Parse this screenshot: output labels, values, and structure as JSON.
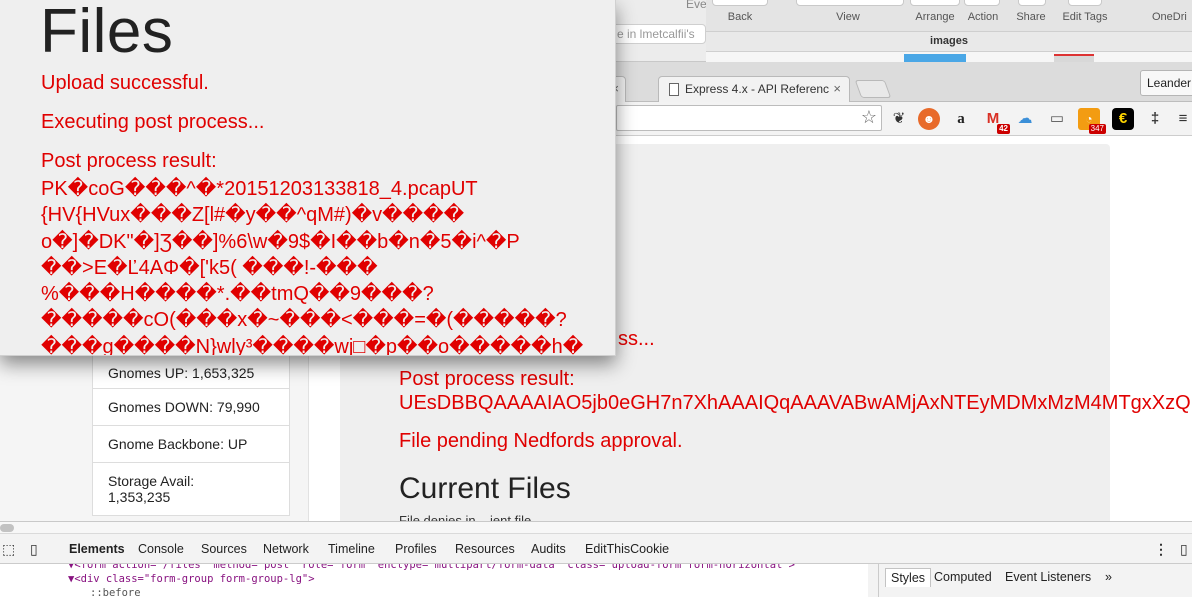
{
  "finder": {
    "top_label": "Eve",
    "search_placeholder": "e in lmetcalfii's",
    "toolbar": [
      "Back",
      "View",
      "Arrange",
      "Action",
      "Share",
      "Edit Tags",
      "OneDri"
    ],
    "path": "images"
  },
  "chrome_back": {
    "tab_title": "Express 4.x - API Referenc",
    "tab_close": "×",
    "profile": "Leander",
    "ext_badges": {
      "gmail": "42",
      "rss": "347"
    },
    "star": "☆"
  },
  "front": {
    "heading": "Files",
    "upload": "Upload successful.",
    "executing": "Executing post process...",
    "post_result_label": "Post process result:",
    "garbage_lines": [
      "PK�coG���^�*20151203133818_4.pcapUT",
      "{HV{HVux���Z[l#�y��^qM#)�v����",
      "o�]�DK\"�]Ʒ��]%6\\w�9$�I��b�n�5�i^�P",
      "��>E�Ľ4AΦ�['k5( ���!-���",
      "%���H����*.��tmQ��9���?",
      "�����ϲO(���x�~���<���=�(�����?",
      "���g����N}wly³����wj□�p��o�����h�",
      "�����������"
    ]
  },
  "page": {
    "stats": [
      "Gnomes UP: 1,653,325",
      "Gnomes DOWN: 79,990",
      "Gnome Backbone: UP",
      "Storage Avail:",
      "1,353,235"
    ],
    "executing_tail": "ss...",
    "post_result_label": "Post process result:",
    "post_result_value": "UEsDBBQAAAAIAO5jb0eGH7n7XhAAAIQqAAAVABwAMjAxNTEyMDMxMzM4MTgxXzQucGNhcFVUCQADiGh",
    "pending": "File pending Nedfords approval.",
    "current_files": "Current Files",
    "sub_text": "File denies in ...ient file ..."
  },
  "devtools": {
    "tabs": [
      "Elements",
      "Console",
      "Sources",
      "Network",
      "Timeline",
      "Profiles",
      "Resources",
      "Audits",
      "EditThisCookie"
    ],
    "code": [
      "▼<form action=\"/files\" method=\"post\" role=\"form\" enctype=\"multipart/form-data\" class=\"upload-form form-horizontal\">",
      "  ▼<div class=\"form-group form-group-lg\">",
      "      ::before"
    ],
    "side_tabs": [
      "Styles",
      "Computed",
      "Event Listeners",
      "»"
    ]
  },
  "colors": {
    "error_red": "#e00000",
    "page_bg": "#efefef"
  }
}
